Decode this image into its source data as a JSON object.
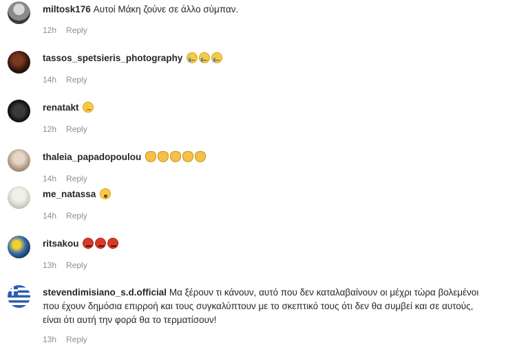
{
  "comments": [
    {
      "user": "miltosk176",
      "text": "Αυτοί Μάκη ζούνε σε άλλο σύμπαν.",
      "time": "12h",
      "reply": "Reply"
    },
    {
      "user": "tassos_spetsieris_photography",
      "text": "",
      "time": "14h",
      "reply": "Reply",
      "emojis": [
        "crying-face",
        "crying-face",
        "crying-face"
      ]
    },
    {
      "user": "renatakt",
      "text": "",
      "time": "12h",
      "reply": "Reply",
      "emojis": [
        "sad-face"
      ]
    },
    {
      "user": "thaleia_papadopoulou",
      "text": "",
      "time": "14h",
      "reply": "Reply",
      "emojis": [
        "clapping-hands",
        "clapping-hands",
        "clapping-hands",
        "clapping-hands",
        "clapping-hands"
      ]
    },
    {
      "user": "me_natassa",
      "text": "",
      "time": "14h",
      "reply": "Reply",
      "emojis": [
        "astonished-face"
      ]
    },
    {
      "user": "ritsakou",
      "text": "",
      "time": "13h",
      "reply": "Reply",
      "emojis": [
        "angry-face",
        "angry-face",
        "angry-face"
      ]
    },
    {
      "user": "stevendimisiano_s.d.official",
      "text_lines": [
        "Μα ξέρουν τι κάνουν, αυτό που δεν καταλαβαίνουν οι μέχρι τώρα βολεμένοι",
        "που έχουν δημόσια επιρροή και τους συγκαλύπτουν με το σκεπτικό τους ότι δεν θα συμβεί και σε αυτούς,",
        "είναι ότι αυτή την φορά θα το τερματίσουν!"
      ],
      "time": "13h",
      "reply": "Reply"
    }
  ],
  "colors": {
    "username": "#262626",
    "meta": "#8e8e8e",
    "background": "#ffffff"
  }
}
